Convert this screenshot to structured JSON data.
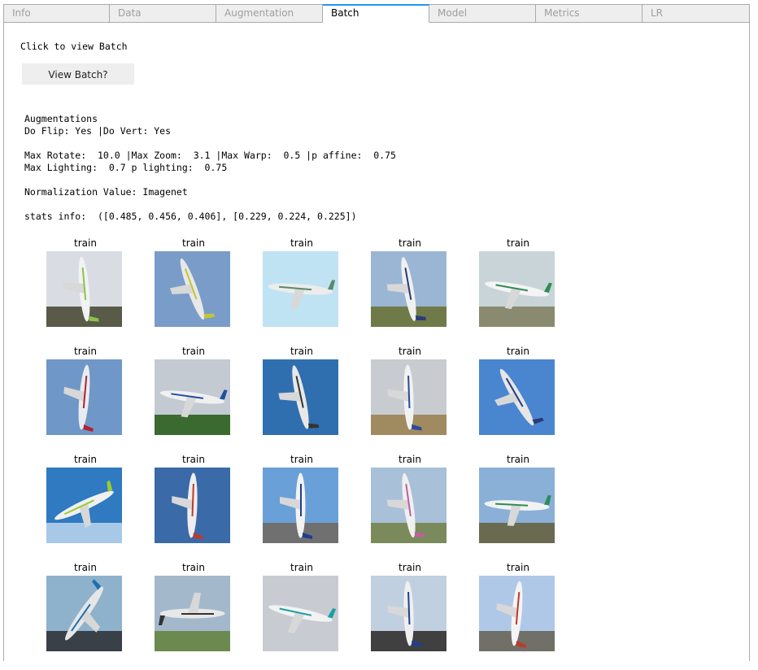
{
  "tabs": [
    {
      "label": "Info",
      "active": false
    },
    {
      "label": "Data",
      "active": false
    },
    {
      "label": "Augmentation",
      "active": false
    },
    {
      "label": "Batch",
      "active": true
    },
    {
      "label": "Model",
      "active": false
    },
    {
      "label": "Metrics",
      "active": false
    },
    {
      "label": "LR",
      "active": false
    }
  ],
  "batch": {
    "click_label": "Click to view Batch",
    "view_button_label": "View Batch?"
  },
  "info": {
    "augmentations_heading": "Augmentations",
    "flip_line": "Do Flip: Yes |Do Vert: Yes",
    "rotate_line": "Max Rotate:  10.0 |Max Zoom:  3.1 |Max Warp:  0.5 |p affine:  0.75",
    "lighting_line": "Max Lighting:  0.7 p lighting:  0.75",
    "normalization_line": "Normalization Value: Imagenet",
    "stats_line": "stats info:  ([0.485, 0.456, 0.406], [0.229, 0.224, 0.225])"
  },
  "images": [
    {
      "caption": "train",
      "sky": "#d9dde3",
      "ground": "#5a5a48",
      "plane": "#f2f2f2",
      "accent": "#8bc34a",
      "angle": 85
    },
    {
      "caption": "train",
      "sky": "#7a9cc8",
      "ground": "#7a9cc8",
      "plane": "#e8e8e8",
      "accent": "#c0c830",
      "angle": 70
    },
    {
      "caption": "train",
      "sky": "#bfe3f3",
      "ground": "#bfe3f3",
      "plane": "#ececec",
      "accent": "#5a8a6a",
      "angle": 5
    },
    {
      "caption": "train",
      "sky": "#9ab6d4",
      "ground": "#6f7a48",
      "plane": "#f0f0f0",
      "accent": "#2a3a7a",
      "angle": 80
    },
    {
      "caption": "train",
      "sky": "#c8d4d8",
      "ground": "#8a8a70",
      "plane": "#f4f4f4",
      "accent": "#2e8b57",
      "angle": 10
    },
    {
      "caption": "train",
      "sky": "#6f97c8",
      "ground": "#6f97c8",
      "plane": "#e9ecef",
      "accent": "#b22234",
      "angle": 95
    },
    {
      "caption": "train",
      "sky": "#c4cad2",
      "ground": "#3a6a30",
      "plane": "#f0f0f0",
      "accent": "#1f4fa0",
      "angle": 8
    },
    {
      "caption": "train",
      "sky": "#2f6fb0",
      "ground": "#2f6fb0",
      "plane": "#e8e8e8",
      "accent": "#333333",
      "angle": 78
    },
    {
      "caption": "train",
      "sky": "#c8ccd0",
      "ground": "#a08a60",
      "plane": "#f2f2f2",
      "accent": "#2a4a9a",
      "angle": 88
    },
    {
      "caption": "train",
      "sky": "#4a86d0",
      "ground": "#4a86d0",
      "plane": "#e6e6e6",
      "accent": "#2a3a7a",
      "angle": 60
    },
    {
      "caption": "train",
      "sky": "#2f7ac0",
      "ground": "#a8c8e8",
      "plane": "#f0f0f0",
      "accent": "#9acd32",
      "angle": -25
    },
    {
      "caption": "train",
      "sky": "#3a6aa8",
      "ground": "#3a6aa8",
      "plane": "#eeeeee",
      "accent": "#c0392b",
      "angle": 92
    },
    {
      "caption": "train",
      "sky": "#6aa0d8",
      "ground": "#707070",
      "plane": "#f2f2f2",
      "accent": "#1f3f8f",
      "angle": 90
    },
    {
      "caption": "train",
      "sky": "#a8c0d8",
      "ground": "#7a8a5a",
      "plane": "#f0f0f0",
      "accent": "#c060a0",
      "angle": 82
    },
    {
      "caption": "train",
      "sky": "#8ab0d8",
      "ground": "#6a6a50",
      "plane": "#f2f2f2",
      "accent": "#2e8b57",
      "angle": 3
    },
    {
      "caption": "train",
      "sky": "#8fb2cc",
      "ground": "#3a4048",
      "plane": "#e6e6e6",
      "accent": "#1f6fb0",
      "angle": -55
    },
    {
      "caption": "train",
      "sky": "#a4b8cc",
      "ground": "#6a8a50",
      "plane": "#e8e8e8",
      "accent": "#333333",
      "angle": 180
    },
    {
      "caption": "train",
      "sky": "#c8ccd2",
      "ground": "#c8ccd2",
      "plane": "#f2f2f2",
      "accent": "#1aa0a0",
      "angle": 12
    },
    {
      "caption": "train",
      "sky": "#c0d0e0",
      "ground": "#404040",
      "plane": "#f0f0f0",
      "accent": "#1f3f8f",
      "angle": 88
    },
    {
      "caption": "train",
      "sky": "#b0c8e8",
      "ground": "#707068",
      "plane": "#f4f4f4",
      "accent": "#c0392b",
      "angle": 95
    }
  ]
}
